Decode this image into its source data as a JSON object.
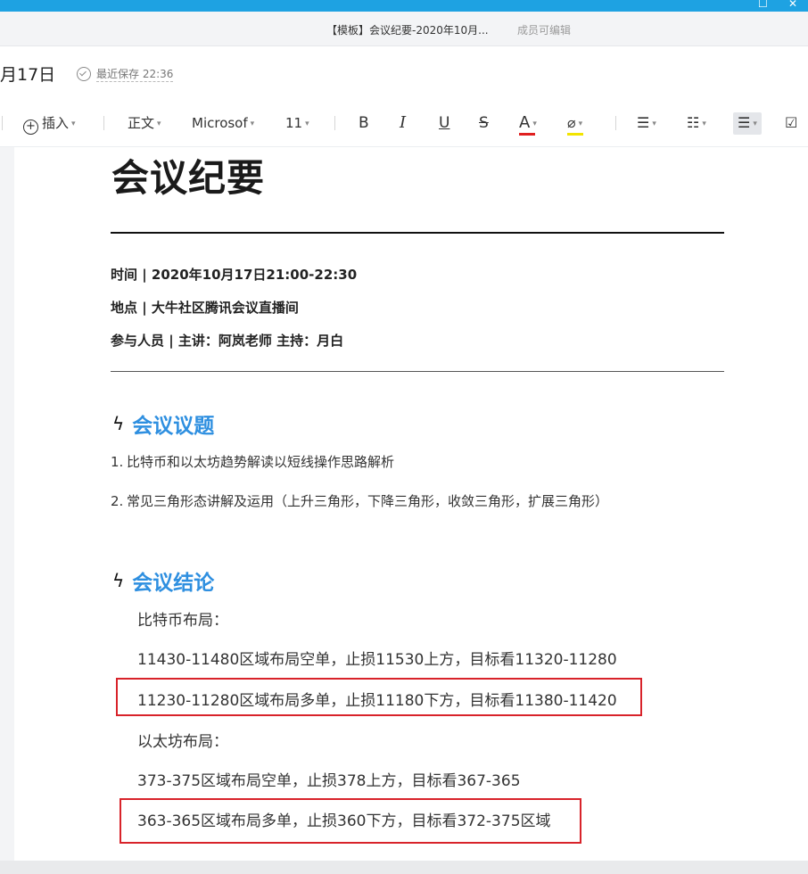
{
  "window": {
    "doc_title": "【模板】会议纪要-2020年10月...",
    "collab_status": "成员可编辑"
  },
  "infobar": {
    "date": "月17日",
    "saved": "最近保存 22:36"
  },
  "toolbar": {
    "insert": "插入",
    "style": "正文",
    "font": "Microsof",
    "size": "11",
    "bold": "B",
    "italic": "I",
    "underline": "U",
    "strike": "S",
    "font_color": "A"
  },
  "doc": {
    "title": "会议纪要",
    "meta": [
      "时间 | 2020年10月17日21:00-22:30",
      "地点 | 大牛社区腾讯会议直播间",
      "参与人员 | 主讲：阿岚老师  主持：月白"
    ],
    "section1": {
      "title": "会议议题",
      "items": [
        {
          "num": "1.",
          "text": "比特币和以太坊趋势解读以短线操作思路解析"
        },
        {
          "num": "2.",
          "text": "常见三角形态讲解及运用（上升三角形，下降三角形，收敛三角形，扩展三角形）"
        }
      ]
    },
    "section2": {
      "title": "会议结论",
      "lines": [
        "比特币布局：",
        "11430-11480区域布局空单，止损11530上方，目标看11320-11280",
        "11230-11280区域布局多单，止损11180下方，目标看11380-11420",
        "以太坊布局：",
        "373-375区域布局空单，止损378上方，目标看367-365",
        "363-365区域布局多单，止损360下方，目标看372-375区域"
      ]
    }
  },
  "colors": {
    "accent": "#2e8fe0",
    "titlebar": "#1ea2e2",
    "highlight_box": "#d8232a"
  }
}
